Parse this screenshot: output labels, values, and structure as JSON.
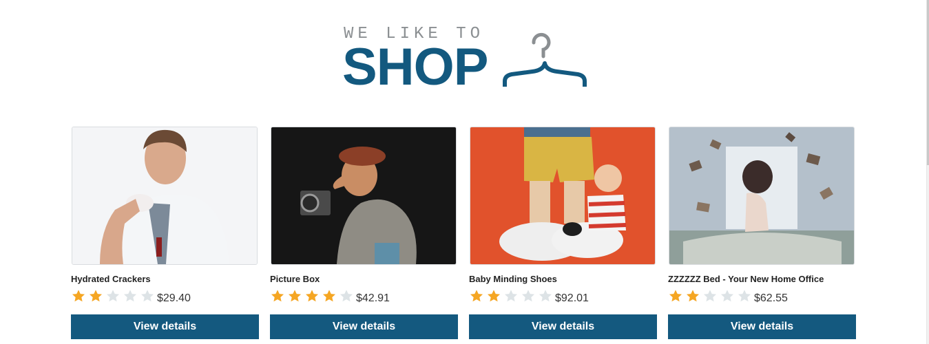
{
  "logo": {
    "tagline": "WE LIKE TO",
    "word": "SHOP",
    "icon": "clothes-hanger-icon",
    "colors": {
      "word": "#13597f",
      "tagline": "#8b8f92",
      "hanger_hook": "#8b8f92",
      "hanger_bar": "#13597f"
    }
  },
  "colors": {
    "button": "#14597f",
    "star_filled": "#f5a623",
    "star_empty": "#dde3e6"
  },
  "products": [
    {
      "name": "Hydrated Crackers",
      "rating": 2,
      "max_rating": 5,
      "price": "$29.40",
      "button_label": "View details"
    },
    {
      "name": "Picture Box",
      "rating": 4,
      "max_rating": 5,
      "price": "$42.91",
      "button_label": "View details"
    },
    {
      "name": "Baby Minding Shoes",
      "rating": 2,
      "max_rating": 5,
      "price": "$92.01",
      "button_label": "View details"
    },
    {
      "name": "ZZZZZZ Bed - Your New Home Office",
      "rating": 2,
      "max_rating": 5,
      "price": "$62.55",
      "button_label": "View details"
    }
  ]
}
